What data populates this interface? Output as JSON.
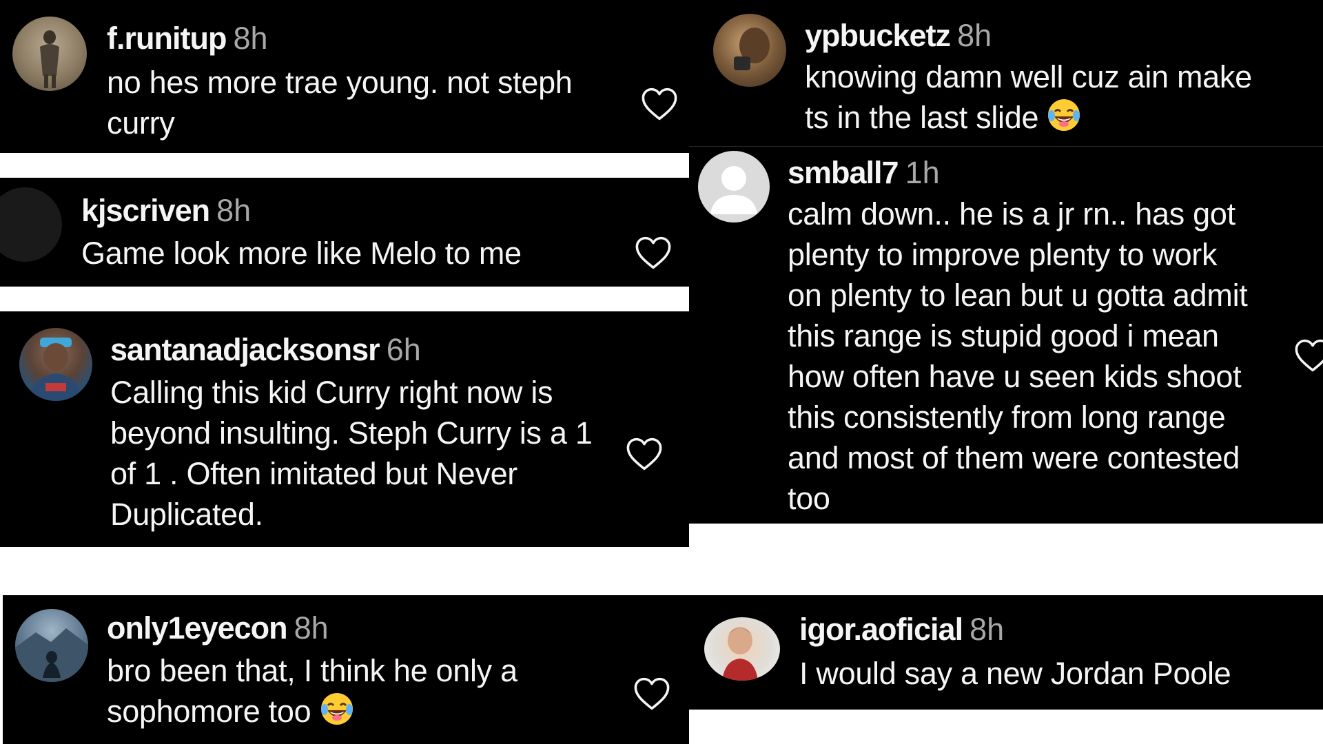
{
  "comments": [
    {
      "username": "f.runitup",
      "time": "8h",
      "text_lines": [
        "no hes more trae young. not steph",
        "curry"
      ]
    },
    {
      "username": "kjscriven",
      "time": "8h",
      "text_lines": [
        "Game look more like Melo to me"
      ]
    },
    {
      "username": "santanadjacksonsr",
      "time": "6h",
      "text_lines": [
        "Calling this kid Curry right now is",
        "beyond insulting. Steph Curry is a 1",
        "of 1 . Often imitated but Never",
        "Duplicated."
      ]
    },
    {
      "username": "only1eyecon",
      "time": "8h",
      "text_lines": [
        "bro been that, I think he only a",
        "sophomore too"
      ]
    },
    {
      "username": "ypbucketz",
      "time": "8h",
      "text_lines": [
        "knowing damn well cuz ain make",
        "ts in the last slide"
      ]
    },
    {
      "username": "smball7",
      "time": "1h",
      "text_lines": [
        "calm down.. he is a jr rn.. has got",
        "plenty to improve plenty to work",
        "on plenty to lean but u gotta admit",
        "this range is stupid good i mean",
        "how often have u seen kids shoot",
        "this consistently from long range",
        "and most of them were contested",
        "too"
      ]
    },
    {
      "username": "igor.aoficial",
      "time": "8h",
      "text_lines": [
        "I would say a new Jordan Poole"
      ]
    }
  ],
  "icons": {
    "like": "heart-outline-icon",
    "emoji": "face-with-tears-of-joy-icon"
  },
  "colors": {
    "card_background": "#000000",
    "page_background": "#ffffff",
    "text": "#f5f5f5",
    "timestamp": "#a8a8a8"
  }
}
